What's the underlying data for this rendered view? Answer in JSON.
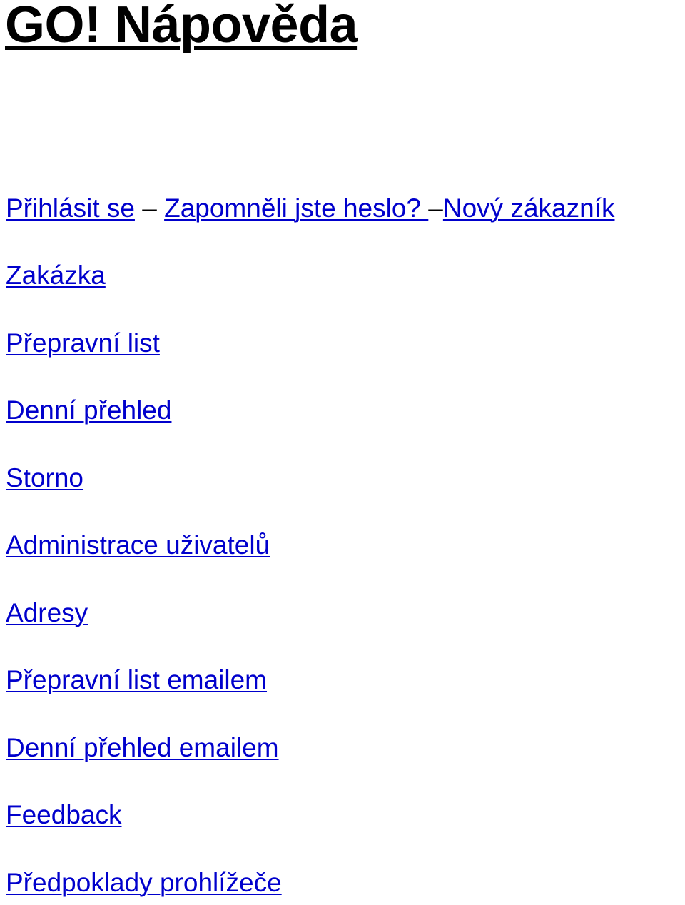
{
  "title": "GO! Nápověda",
  "top_links": {
    "login": "Přihlásit se",
    "separator1": " – ",
    "forgot_password": "Zapomněli jste heslo? ",
    "separator2": "–",
    "new_customer": "Nový zákazník"
  },
  "links": [
    "Zakázka",
    "Přepravní list",
    "Denní přehled",
    "Storno",
    "Administrace uživatelů",
    "Adresy",
    "Přepravní list emailem",
    "Denní přehled emailem",
    "Feedback",
    "Předpoklady prohlížeče"
  ],
  "colors": {
    "link": "#0000cc",
    "title": "#000000"
  }
}
